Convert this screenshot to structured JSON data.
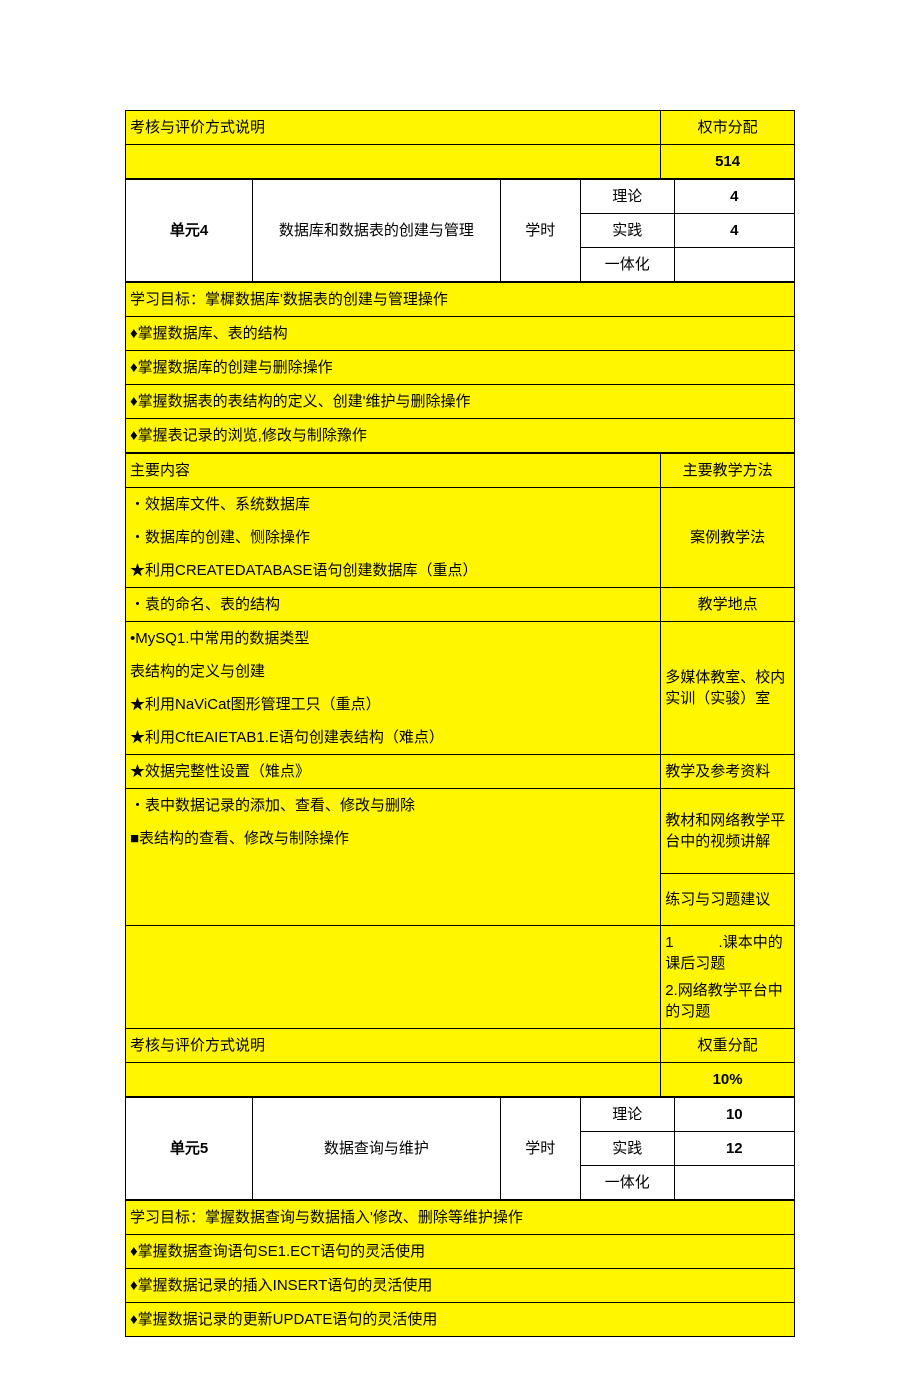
{
  "prev_assess": {
    "label": "考核与评价方式说明",
    "weight_label": "权市分配",
    "weight_value": "514"
  },
  "unit4": {
    "unit_label": "单元4",
    "unit_title": "数据库和数据表的创建与管理",
    "hours_label": "学时",
    "theory_label": "理论",
    "theory_value": "4",
    "practice_label": "实践",
    "practice_value": "4",
    "integrated_label": "一体化",
    "integrated_value": "",
    "goal_title": " 学习目标：掌樨数据库'数据表的创建与管理操作",
    "goals": [
      "♦掌握数据库、表的结构",
      "♦掌握数据库的创建与删除操作",
      "♦掌握数据表的表结构的定义、创建'维护与删除操作",
      "♦掌握表记录的浏览,修改与制除豫作"
    ],
    "content_header": "主要内容",
    "method_header": "主要教学方法",
    "content_a": [
      "・效据库文件、系统数据库",
      "・数据库的创建、恻除操作",
      "★利用CREATEDATABASE语句创建数据库（重点）"
    ],
    "method_a": "案例教学法",
    "content_b0": "・袁的命名、表的结构",
    "location_label": "教学地点",
    "content_b_rest": [
      "•MySQ1.中常用的数据类型",
      "表结构的定义与创建",
      "★利用NaViCat图形管理工只（重点）",
      "★利用CftEAIETAB1.E语句创建表结构（难点）"
    ],
    "location_value": "多媒体教室、校内实训（实骏）室",
    "content_c0": "★效据完整性设置（雉点》",
    "ref_label": "教学及参考资料",
    "content_c_rest": [
      "・表中数据记录的添加、查看、修改与删除",
      "■表结构的查看、修改与制除操作"
    ],
    "ref_value": "教材和网络教学平台中的视频讲解",
    "exercise_label": "练习与习题建议",
    "exercise_value_1": "1　　　.课本中的课后习题",
    "exercise_value_2": "2.网络教学平台中的习题",
    "assess_label": "考核与评价方式说明",
    "weight_label": "权重分配",
    "weight_value": "10%"
  },
  "unit5": {
    "unit_label": "单元5",
    "unit_title": "数据查询与维护",
    "hours_label": "学时",
    "theory_label": "理论",
    "theory_value": "10",
    "practice_label": "实践",
    "practice_value": "12",
    "integrated_label": "一体化",
    "integrated_value": "",
    "goal_title": " 学习目标：掌握数据查询与数据插入'修改、删除等维护操作",
    "goals": [
      "♦掌握数据查询语句SE1.ECT语句的灵活使用",
      "♦掌握数据记录的插入INSERT语句的灵活使用",
      "♦掌握数据记录的更新UPDATE语句的灵活使用"
    ]
  }
}
